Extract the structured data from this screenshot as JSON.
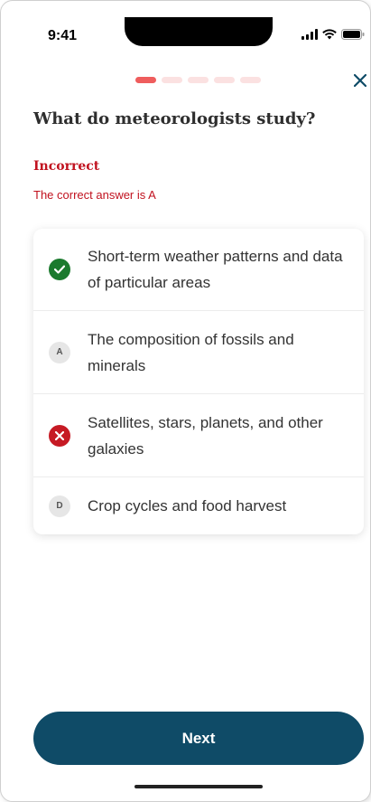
{
  "status_bar": {
    "time": "9:41"
  },
  "progress": {
    "total_steps": 5,
    "current_step": 1
  },
  "question": {
    "text": "What do meteorologists study?"
  },
  "feedback": {
    "result": "Incorrect",
    "detail": "The correct answer is A"
  },
  "options": [
    {
      "state": "correct",
      "letter": "",
      "text": "Short-term weather patterns and data of particular areas"
    },
    {
      "state": "default",
      "letter": "A",
      "text": "The composition of fossils and minerals"
    },
    {
      "state": "wrong",
      "letter": "",
      "text": "Satellites, stars, planets, and other galaxies"
    },
    {
      "state": "default",
      "letter": "D",
      "text": "Crop cycles and food harvest"
    }
  ],
  "actions": {
    "next_label": "Next"
  },
  "colors": {
    "accent_red": "#c1121f",
    "correct_green": "#1b7a2e",
    "button_teal": "#0f4b67",
    "progress_active": "#ef5d5d",
    "progress_inactive": "#fbe1e1"
  }
}
